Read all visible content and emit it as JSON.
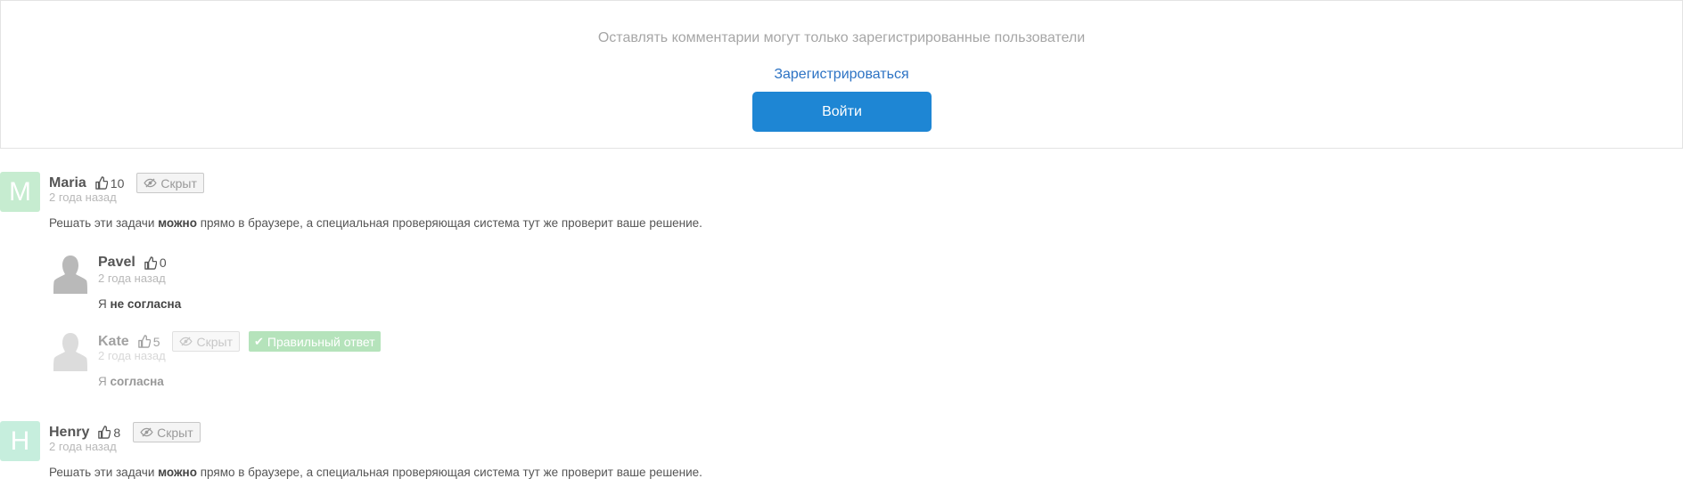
{
  "login": {
    "notice": "Оставлять комментарии могут только зарегистрированные пользователи",
    "register_link": "Зарегистрироваться",
    "login_button": "Войти"
  },
  "labels": {
    "hidden": "Скрыт",
    "correct_answer": "Правильный ответ"
  },
  "comments": [
    {
      "avatar_letter": "M",
      "avatar_color": "#c6ecd0",
      "author": "Maria",
      "likes": "10",
      "time": "2 года назад",
      "text_before": "Решать эти задачи ",
      "text_bold": "можно",
      "text_after": " прямо в браузере, а специальная проверяющая система тут же проверит ваше решение."
    },
    {
      "author": "Pavel",
      "likes": "0",
      "time": "2 года назад",
      "text_before": "Я ",
      "text_bold": "не согласна",
      "text_after": ""
    },
    {
      "author": "Kate",
      "likes": "5",
      "time": "2 года назад",
      "text_before": "Я ",
      "text_bold": "согласна",
      "text_after": ""
    },
    {
      "avatar_letter": "H",
      "avatar_color": "#c6eedd",
      "author": "Henry",
      "likes": "8",
      "time": "2 года назад",
      "text_before": "Решать эти задачи ",
      "text_bold": "можно",
      "text_after": " прямо в браузере, а специальная проверяющая система тут же проверит ваше решение."
    }
  ]
}
